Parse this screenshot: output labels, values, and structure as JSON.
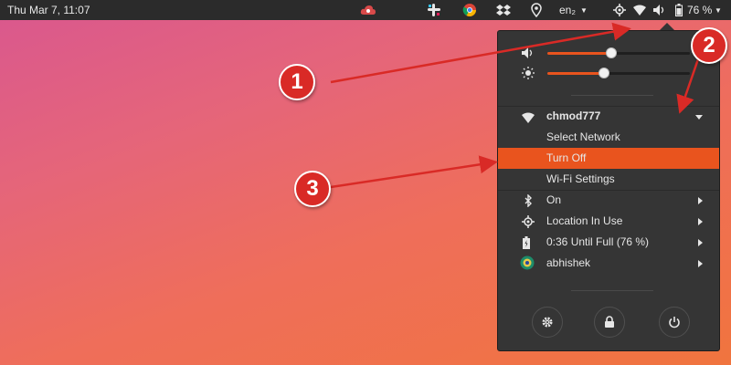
{
  "topbar": {
    "clock": "Thu Mar  7, 11:07",
    "keyboard_layout": "en₂",
    "battery_percent": "76 %"
  },
  "menu": {
    "volume_level": 0.45,
    "brightness_level": 0.4,
    "wifi": {
      "network_name": "chmod777",
      "items": [
        "Select Network",
        "Turn Off",
        "Wi-Fi Settings"
      ]
    },
    "bluetooth": {
      "label": "On"
    },
    "location": {
      "label": "Location In Use"
    },
    "battery": {
      "label": "0:36 Until Full (76 %)"
    },
    "user": {
      "label": "abhishek"
    }
  },
  "annotations": {
    "one": "1",
    "two": "2",
    "three": "3",
    "color": "#d92a26"
  },
  "colors": {
    "accent": "#e9541e",
    "topbar": "#2b2b2b",
    "menu_bg": "#353535"
  }
}
